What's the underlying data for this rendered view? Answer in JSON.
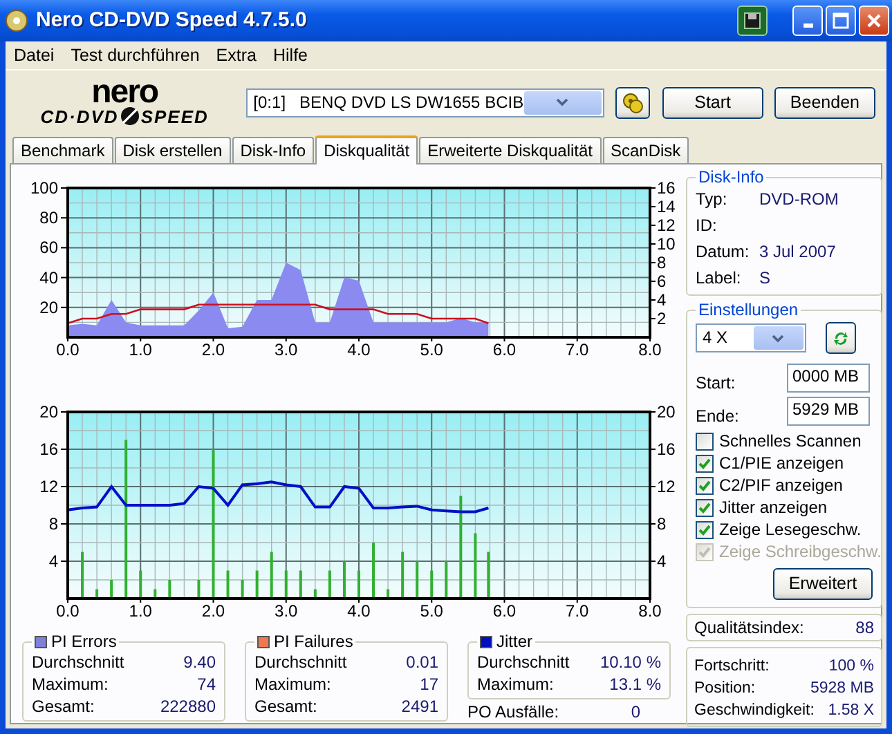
{
  "window": {
    "title": "Nero CD-DVD Speed 4.7.5.0"
  },
  "menu": [
    "Datei",
    "Test durchführen",
    "Extra",
    "Hilfe"
  ],
  "logo": {
    "top": "nero",
    "left": "CD·DVD",
    "right": "SPEED"
  },
  "drive": {
    "value": "[0:1]   BENQ DVD LS DW1655 BCIB"
  },
  "buttons": [
    "Start",
    "Beenden"
  ],
  "tabs": [
    {
      "label": "Benchmark",
      "selected": false
    },
    {
      "label": "Disk erstellen",
      "selected": false
    },
    {
      "label": "Disk-Info",
      "selected": false
    },
    {
      "label": "Diskqualität",
      "selected": true
    },
    {
      "label": "Erweiterte Diskqualität",
      "selected": false
    },
    {
      "label": "ScanDisk",
      "selected": false
    }
  ],
  "charts": [
    {
      "chart_data": {
        "type": "area",
        "grid": true,
        "xlim": [
          0,
          8
        ],
        "ylim": [
          0,
          100
        ],
        "y2lim": [
          0,
          16
        ],
        "xticks": [
          {
            "value": 0,
            "label": "0.0"
          },
          {
            "value": 1,
            "label": "1.0"
          },
          {
            "value": 2,
            "label": "2.0"
          },
          {
            "value": 3,
            "label": "3.0"
          },
          {
            "value": 4,
            "label": "4.0"
          },
          {
            "value": 5,
            "label": "5.0"
          },
          {
            "value": 6,
            "label": "6.0"
          },
          {
            "value": 7,
            "label": "7.0"
          },
          {
            "value": 8,
            "label": "8.0"
          }
        ],
        "yticks": [
          20,
          40,
          60,
          80,
          100
        ],
        "y2ticks": [
          2,
          4,
          6,
          8,
          10,
          12,
          14,
          16
        ],
        "x": [
          0,
          0.2,
          0.4,
          0.6,
          0.8,
          1.0,
          1.2,
          1.4,
          1.6,
          1.8,
          2.0,
          2.2,
          2.4,
          2.6,
          2.8,
          3.0,
          3.2,
          3.4,
          3.6,
          3.8,
          4.0,
          4.2,
          4.4,
          4.6,
          4.8,
          5.0,
          5.2,
          5.4,
          5.6,
          5.78
        ],
        "series": [
          {
            "color": "#8a8af0",
            "values": [
              8,
              9,
              8,
              25,
              10,
              8,
              8,
              8,
              8,
              18,
              30,
              6,
              7,
              25,
              25,
              50,
              45,
              10,
              10,
              40,
              38,
              10,
              10,
              10,
              10,
              10,
              10,
              13,
              10,
              10
            ]
          },
          {
            "type": "line",
            "axis": "y2",
            "color": "#cc1020",
            "values": [
              1.5,
              2,
              2,
              2.5,
              2.5,
              3,
              3,
              3,
              3,
              3.5,
              3.5,
              3.5,
              3.5,
              3.5,
              3.5,
              3.5,
              3.5,
              3.5,
              3,
              3,
              3,
              3,
              2.5,
              2.5,
              2.5,
              2,
              2,
              2,
              2,
              1.5
            ]
          }
        ]
      }
    },
    {
      "chart_data": {
        "type": "bar",
        "grid": true,
        "xlim": [
          0,
          8
        ],
        "ylim": [
          0,
          20
        ],
        "y2lim": [
          0,
          20
        ],
        "xticks": [
          {
            "value": 0,
            "label": "0.0"
          },
          {
            "value": 1,
            "label": "1.0"
          },
          {
            "value": 2,
            "label": "2.0"
          },
          {
            "value": 3,
            "label": "3.0"
          },
          {
            "value": 4,
            "label": "4.0"
          },
          {
            "value": 5,
            "label": "5.0"
          },
          {
            "value": 6,
            "label": "6.0"
          },
          {
            "value": 7,
            "label": "7.0"
          },
          {
            "value": 8,
            "label": "8.0"
          }
        ],
        "yticks": [
          4,
          8,
          12,
          16,
          20
        ],
        "y2ticks": [
          4,
          8,
          12,
          16,
          20
        ],
        "x": [
          0,
          0.2,
          0.4,
          0.6,
          0.8,
          1.0,
          1.2,
          1.4,
          1.6,
          1.8,
          2.0,
          2.2,
          2.4,
          2.6,
          2.8,
          3.0,
          3.2,
          3.4,
          3.6,
          3.8,
          4.0,
          4.2,
          4.4,
          4.6,
          4.8,
          5.0,
          5.2,
          5.4,
          5.6,
          5.78
        ],
        "series": [
          {
            "color": "#30b030",
            "values": [
              null,
              5,
              1,
              2,
              17,
              3,
              1,
              2,
              0,
              2,
              16,
              3,
              2,
              3,
              5,
              3,
              3,
              1,
              3,
              4,
              3,
              6,
              1,
              5,
              4,
              3,
              4,
              11,
              7,
              5
            ]
          },
          {
            "type": "line",
            "axis": "y2",
            "color": "#0010c8",
            "values": [
              9.5,
              9.7,
              9.8,
              12,
              10,
              10,
              10,
              10,
              10.2,
              12,
              11.8,
              10,
              12.2,
              12.3,
              12.5,
              12.2,
              12,
              9.8,
              9.8,
              12,
              11.8,
              9.7,
              9.7,
              9.8,
              9.9,
              9.5,
              9.4,
              9.3,
              9.3,
              9.7
            ]
          }
        ]
      }
    }
  ],
  "stats": [
    {
      "title": "PI Errors",
      "color": "#8080d8",
      "rows": [
        {
          "label": "Durchschnitt",
          "value": "9.40"
        },
        {
          "label": "Maximum:",
          "value": "74"
        },
        {
          "label": "Gesamt:",
          "value": "222880"
        }
      ]
    },
    {
      "title": "PI Failures",
      "color": "#f07850",
      "rows": [
        {
          "label": "Durchschnitt",
          "value": "0.01"
        },
        {
          "label": "Maximum:",
          "value": "17"
        },
        {
          "label": "Gesamt:",
          "value": "2491"
        }
      ]
    },
    {
      "title": "Jitter",
      "color": "#0010c0",
      "rows": [
        {
          "label": "Durchschnitt",
          "value": "10.10 %"
        },
        {
          "label": "Maximum:",
          "value": "13.1 %"
        }
      ]
    }
  ],
  "po_failures": {
    "label": "PO Ausfälle:",
    "value": "0"
  },
  "disk_info": {
    "title": "Disk-Info",
    "rows": [
      {
        "label": "Typ:",
        "value": "DVD-ROM"
      },
      {
        "label": "ID:"
      },
      {
        "label": "Datum:",
        "value": "3 Jul 2007"
      },
      {
        "label": "Label:",
        "value": "S"
      }
    ]
  },
  "settings": {
    "title": "Einstellungen",
    "speed": "4 X",
    "start": {
      "label": "Start:",
      "value": "0000 MB"
    },
    "end": {
      "label": "Ende:",
      "value": "5929 MB"
    },
    "checkboxes": [
      {
        "label": "Schnelles Scannen",
        "checked": false,
        "disabled": false
      },
      {
        "label": "C1/PIE anzeigen",
        "checked": true,
        "disabled": false
      },
      {
        "label": "C2/PIF anzeigen",
        "checked": true,
        "disabled": false
      },
      {
        "label": "Jitter anzeigen",
        "checked": true,
        "disabled": false
      },
      {
        "label": "Zeige Lesegeschw.",
        "checked": true,
        "disabled": false
      },
      {
        "label": "Zeige Schreibgeschw.",
        "checked": true,
        "disabled": true
      }
    ],
    "advanced_button": "Erweitert"
  },
  "quality": {
    "label": "Qualitätsindex:",
    "value": "88"
  },
  "progress": [
    {
      "label": "Fortschritt:",
      "value": "100 %"
    },
    {
      "label": "Position:",
      "value": "5928 MB"
    },
    {
      "label": "Geschwindigkeit:",
      "value": "1.58 X"
    }
  ]
}
